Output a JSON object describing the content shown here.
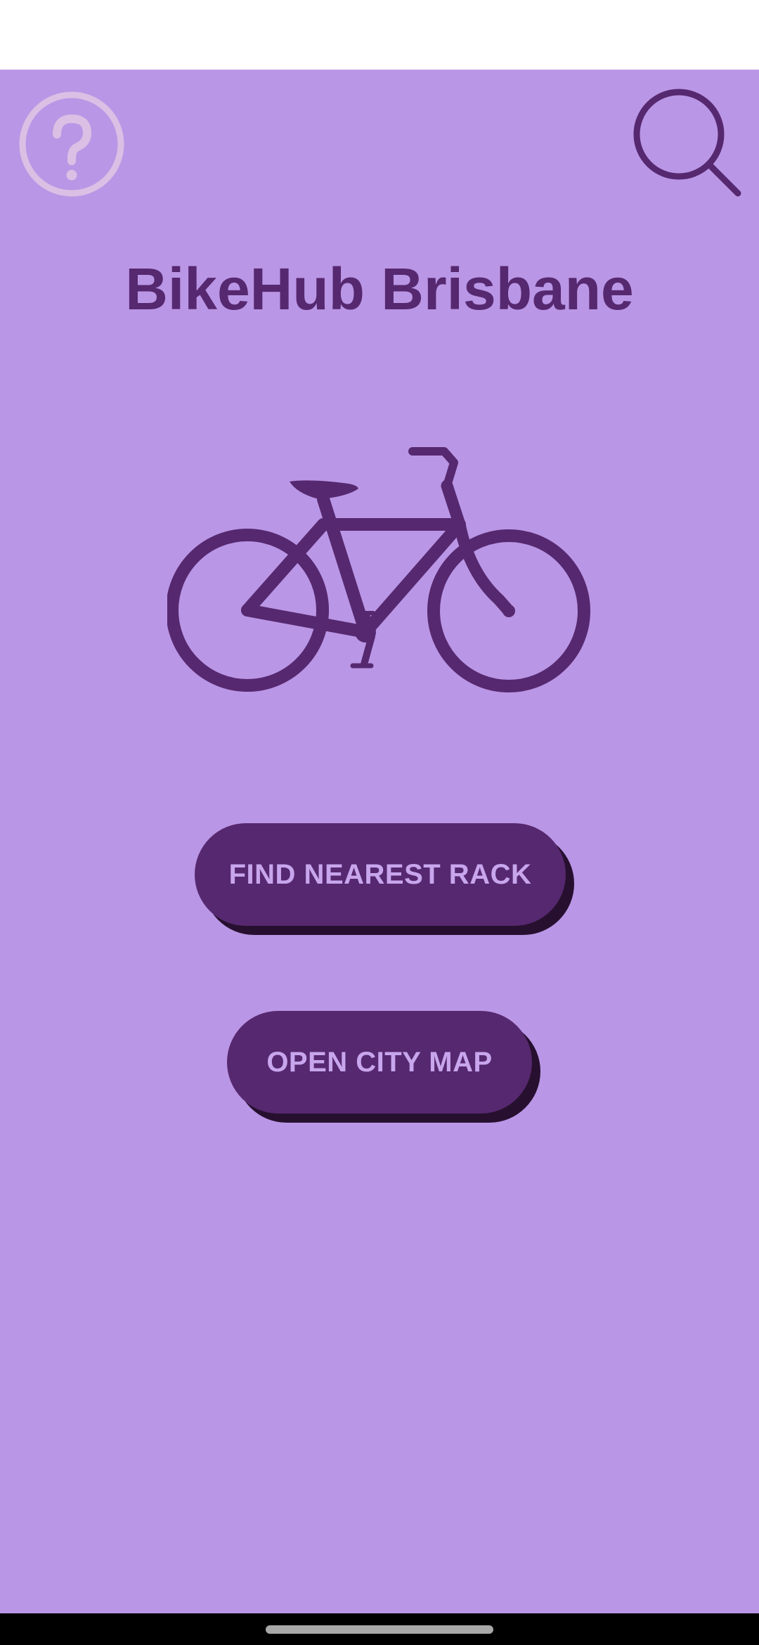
{
  "app": {
    "title": "BikeHub Brisbane",
    "background_color": "#ba96e6",
    "accent_color": "#56286f"
  },
  "toolbar": {
    "help_icon": "help-circle-icon",
    "search_icon": "search-icon"
  },
  "hero": {
    "icon": "bicycle-icon"
  },
  "actions": {
    "find_rack_label": "FIND NEAREST RACK",
    "open_map_label": "OPEN CITY MAP"
  }
}
